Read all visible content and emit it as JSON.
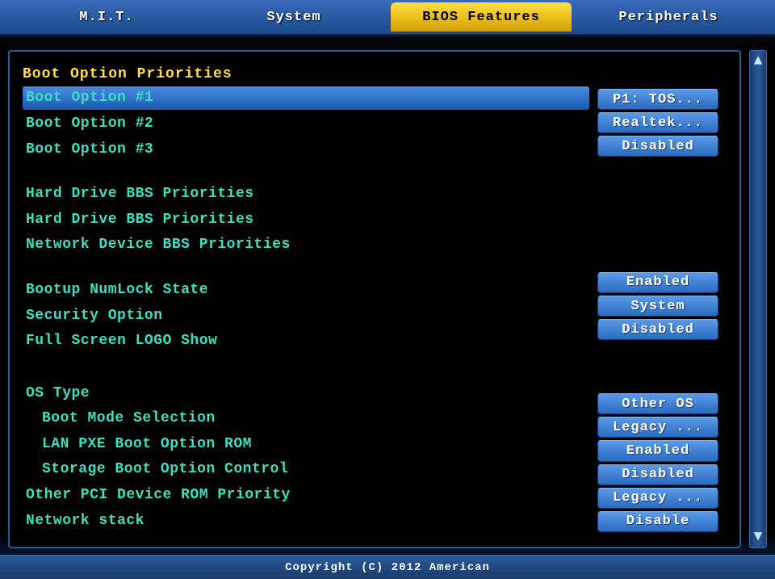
{
  "tabs": {
    "miy": "M.I.T.",
    "system": "System",
    "bios_features": "BIOS Features",
    "peripherals": "Peripherals"
  },
  "section_header": "Boot Option Priorities",
  "boot_options": [
    {
      "label": "Boot Option #1",
      "value": "P1: TOS..."
    },
    {
      "label": "Boot Option #2",
      "value": "Realtek..."
    },
    {
      "label": "Boot Option #3",
      "value": "Disabled"
    }
  ],
  "bbs": {
    "hdd1": "Hard Drive BBS Priorities",
    "hdd2": "Hard Drive BBS Priorities",
    "net": "Network Device BBS Priorities"
  },
  "settings1": [
    {
      "label": "Bootup NumLock State",
      "value": "Enabled"
    },
    {
      "label": "Security Option",
      "value": "System"
    },
    {
      "label": "Full Screen LOGO Show",
      "value": "Disabled"
    }
  ],
  "os_type_header": "OS Type",
  "settings2": [
    {
      "label": "Boot Mode Selection",
      "value": "Other OS"
    },
    {
      "label": "LAN PXE Boot Option ROM",
      "value": "Legacy ..."
    },
    {
      "label": "Storage Boot Option Control",
      "value": "Enabled"
    },
    {
      "label": "Other PCI Device ROM Priority",
      "value": "Disabled"
    },
    {
      "label": "Network stack",
      "value": "Legacy ..."
    }
  ],
  "trailing_value": "Disable",
  "footer": "Copyright (C) 2012 American"
}
